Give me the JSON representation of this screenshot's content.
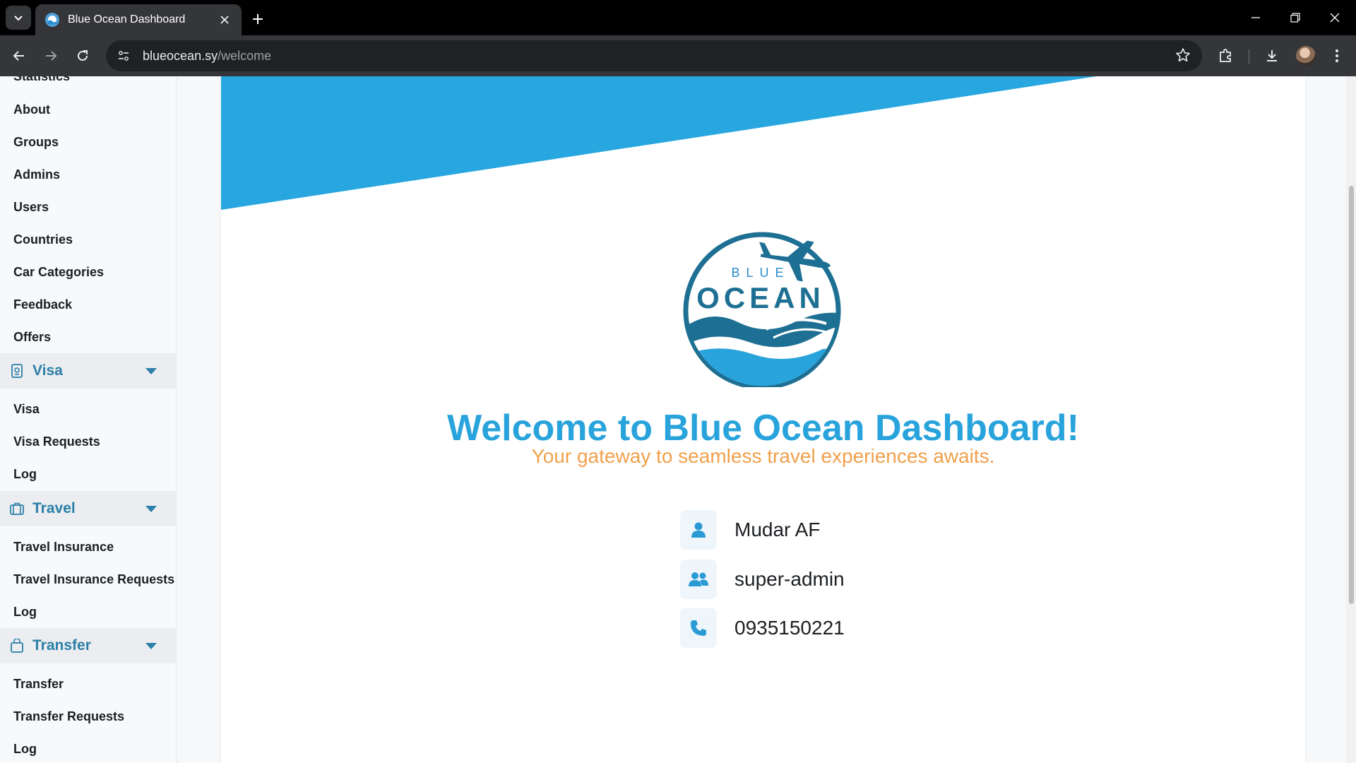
{
  "browser": {
    "tab_title": "Blue Ocean Dashboard",
    "url_host": "blueocean.sy",
    "url_path": "/welcome"
  },
  "sidebar": {
    "partial_top_item": "Statistics",
    "general_items": [
      "About",
      "Groups",
      "Admins",
      "Users",
      "Countries",
      "Car Categories",
      "Feedback",
      "Offers"
    ],
    "groups": [
      {
        "label": "Visa",
        "icon": "passport-icon",
        "items": [
          "Visa",
          "Visa Requests",
          "Log"
        ]
      },
      {
        "label": "Travel",
        "icon": "suitcase-icon",
        "items": [
          "Travel Insurance",
          "Travel Insurance Requests",
          "Log"
        ]
      },
      {
        "label": "Transfer",
        "icon": "bag-icon",
        "items": [
          "Transfer",
          "Transfer Requests",
          "Log"
        ]
      }
    ]
  },
  "main": {
    "logo": {
      "top_word": "BLUE",
      "main_word": "OCEAN"
    },
    "welcome_title": "Welcome to Blue Ocean Dashboard!",
    "subtitle": "Your gateway to seamless travel experiences awaits.",
    "profile": {
      "name": "Mudar AF",
      "role": "super-admin",
      "phone": "0935150221"
    }
  },
  "colors": {
    "brand_blue": "#29a3dc",
    "banner_blue": "#27a6df",
    "accent_orange": "#f0a04b",
    "sidebar_group_text": "#2b7fa8",
    "logo_dark": "#1d6f93"
  }
}
